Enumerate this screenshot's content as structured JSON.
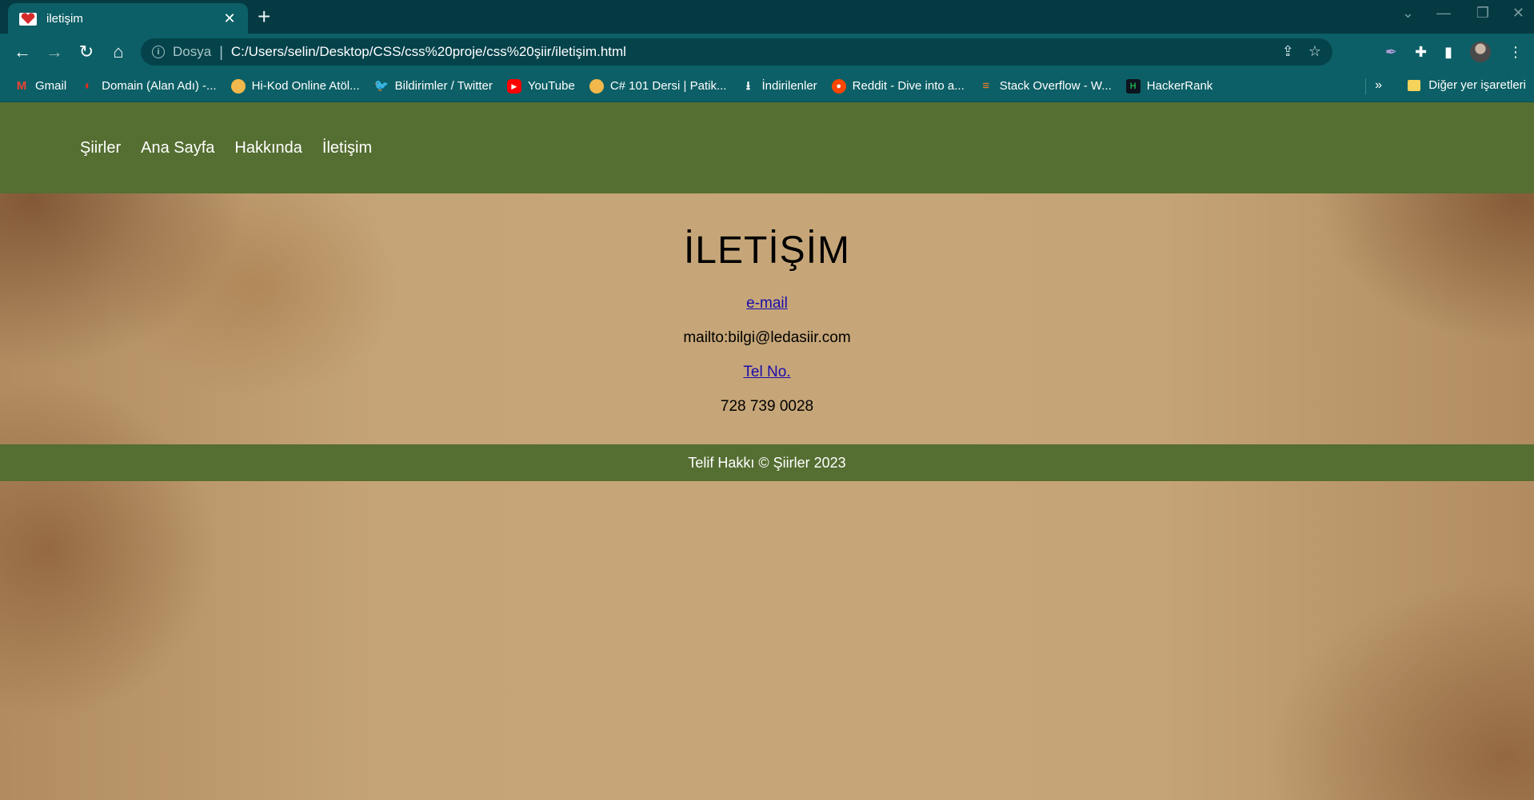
{
  "browser": {
    "tab_title": "iletişim",
    "new_tab": "+",
    "tab_close": "✕",
    "url_scheme": "Dosya",
    "url_sep": "|",
    "url": "C:/Users/selin/Desktop/CSS/css%20proje/css%20şiir/iletişim.html",
    "bookmarks": [
      {
        "label": "Gmail",
        "icon": "gmail-icon",
        "color": "#ea4335"
      },
      {
        "label": "Domain (Alan Adı) -...",
        "icon": "domain-icon",
        "color": "#d93025"
      },
      {
        "label": "Hi-Kod Online Atöl...",
        "icon": "hikod-icon",
        "color": "#f2b84b"
      },
      {
        "label": "Bildirimler / Twitter",
        "icon": "twitter-icon",
        "color": "#1d9bf0"
      },
      {
        "label": "YouTube",
        "icon": "youtube-icon",
        "color": "#ff0000"
      },
      {
        "label": "C# 101 Dersi | Patik...",
        "icon": "patika-icon",
        "color": "#f2b84b"
      },
      {
        "label": "İndirilenler",
        "icon": "download-icon",
        "color": "#ffffff"
      },
      {
        "label": "Reddit - Dive into a...",
        "icon": "reddit-icon",
        "color": "#ff4500"
      },
      {
        "label": "Stack Overflow - W...",
        "icon": "stackoverflow-icon",
        "color": "#f48024"
      },
      {
        "label": "HackerRank",
        "icon": "hackerrank-icon",
        "color": "#1ba94c"
      }
    ],
    "bookmarks_more": "»",
    "other_bookmarks": "Diğer yer işaretleri"
  },
  "nav": {
    "items": [
      "Şiirler",
      "Ana Sayfa",
      "Hakkında",
      "İletişim"
    ]
  },
  "main": {
    "heading": "İLETİŞİM",
    "email_link": "e-mail",
    "email_text": "mailto:bilgi@ledasiir.com",
    "phone_link": "Tel No.",
    "phone_text": "728 739 0028"
  },
  "footer": {
    "text": "Telif Hakkı © Şiirler 2023"
  },
  "colors": {
    "nav_bg": "#556e32",
    "browser_chrome": "#0c5f66",
    "link": "#1a0dab"
  }
}
